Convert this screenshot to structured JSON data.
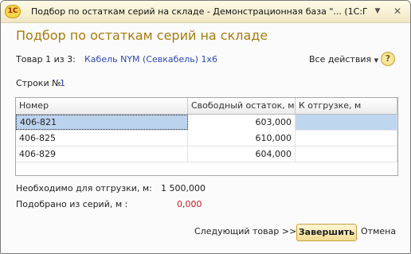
{
  "window": {
    "app_logo": "1С",
    "title": "Подбор по остаткам серий на складе - Демонстрационная база \"... (1С:Предприятие)",
    "menu_icon": "▼",
    "close_icon": "✕"
  },
  "form": {
    "title": "Подбор по остаткам серий на складе",
    "item_counter": "Товар 1 из 3:",
    "item_name": "Кабель NYM (Севкабель) 1х6",
    "all_actions": "Все действия",
    "help_icon": "?",
    "rows_label": "Строки №:",
    "rows_value": "1"
  },
  "table": {
    "columns": [
      "Номер",
      "Свободный остаток, м",
      "К отгрузке, м"
    ],
    "rows": [
      {
        "number": "406-821",
        "free": "603,000",
        "ship": ""
      },
      {
        "number": "406-825",
        "free": "610,000",
        "ship": ""
      },
      {
        "number": "406-829",
        "free": "604,000",
        "ship": ""
      }
    ],
    "selected_row": 0
  },
  "summary": {
    "needed_label": "Необходимо для отгрузки, м:",
    "needed_value": "1 500,000",
    "picked_label": "Подобрано из серий, м :",
    "picked_value": "0,000"
  },
  "buttons": {
    "next": "Следующий товар >>",
    "finish": "Завершить",
    "cancel": "Отмена"
  },
  "colors": {
    "accent_title": "#a87c0b",
    "link": "#2d47b8",
    "negative": "#c32121",
    "selection": "#bfd6ef"
  }
}
